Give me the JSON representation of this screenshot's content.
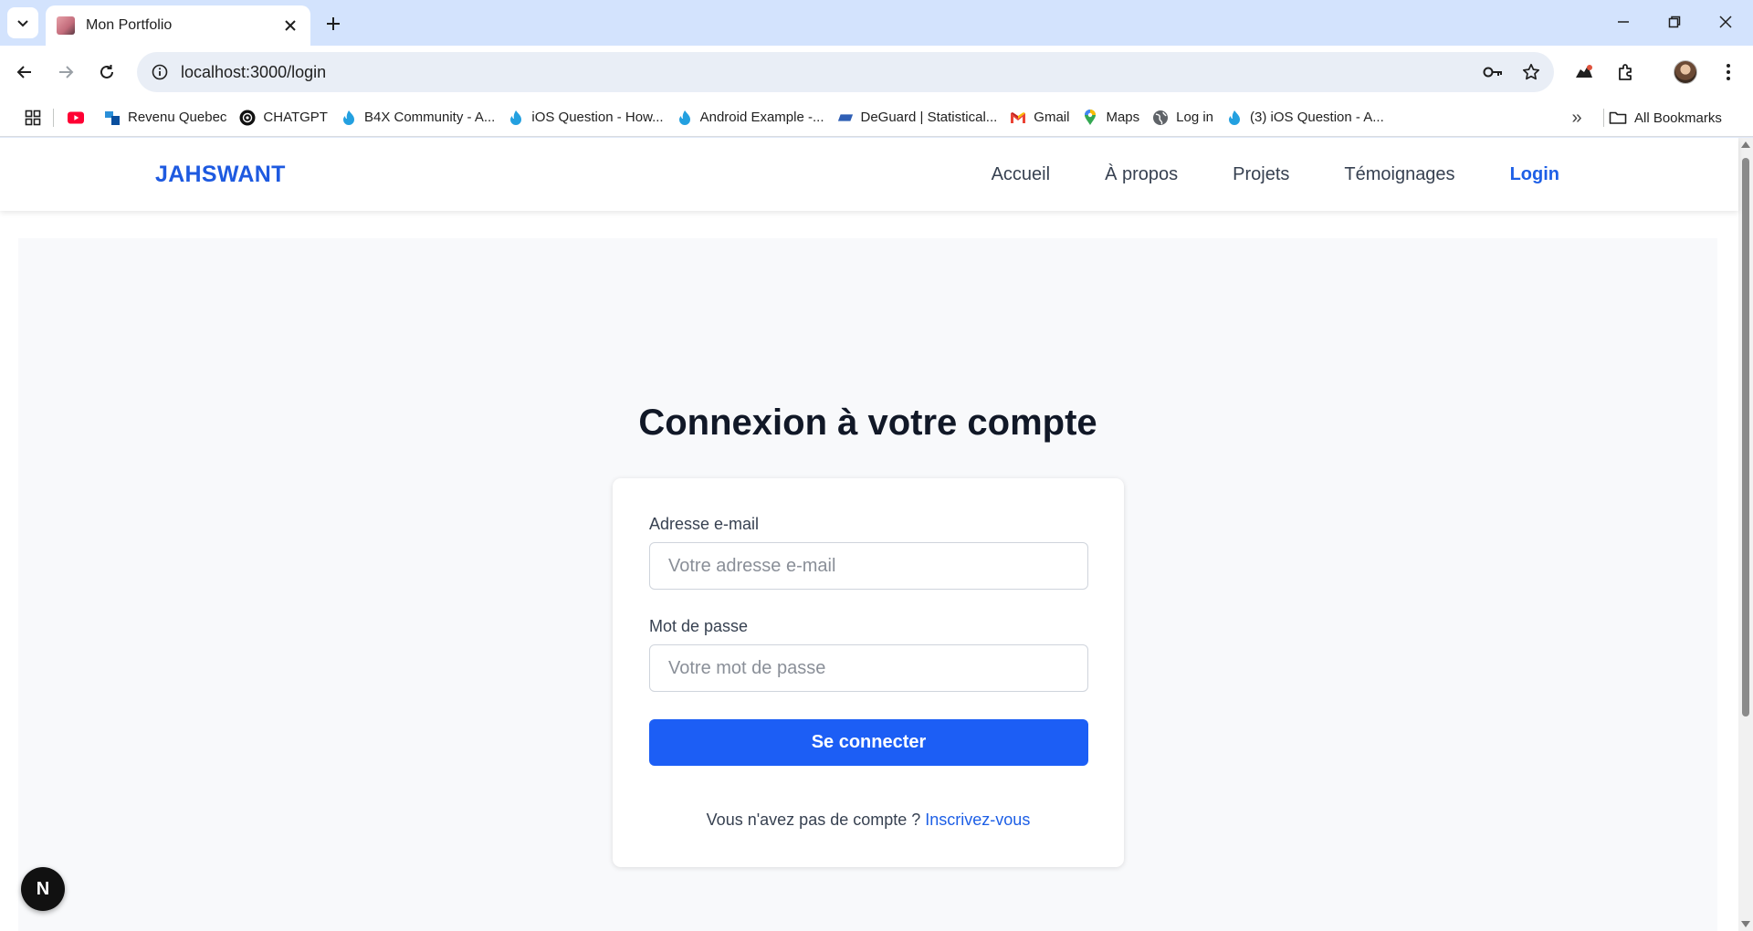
{
  "browser": {
    "tab_title": "Mon Portfolio",
    "url": "localhost:3000/login",
    "bookmarks": [
      {
        "label": "",
        "icon": "youtube-icon",
        "color": "#ff0033"
      },
      {
        "label": "Revenu Quebec",
        "icon": "revenu-quebec-icon",
        "color": "#2a8fd8"
      },
      {
        "label": "CHATGPT",
        "icon": "chatgpt-icon",
        "color": "#111111"
      },
      {
        "label": "B4X Community - A...",
        "icon": "b4x-icon",
        "color": "#23a0e0"
      },
      {
        "label": "iOS Question - How...",
        "icon": "b4x-icon",
        "color": "#23a0e0"
      },
      {
        "label": "Android Example -...",
        "icon": "b4x-icon",
        "color": "#23a0e0"
      },
      {
        "label": "DeGuard | Statistical...",
        "icon": "deguard-icon",
        "color": "#2f5fb5"
      },
      {
        "label": "Gmail",
        "icon": "gmail-icon",
        "color": "#ea4335"
      },
      {
        "label": "Maps",
        "icon": "maps-icon",
        "color": "#34a853"
      },
      {
        "label": "Log in",
        "icon": "globe-icon",
        "color": "#5f6368"
      },
      {
        "label": "(3) iOS Question - A...",
        "icon": "b4x-icon",
        "color": "#23a0e0"
      }
    ],
    "all_bookmarks_label": "All Bookmarks",
    "overflow_label": "»"
  },
  "site": {
    "brand": "JAHSWANT",
    "nav": [
      {
        "label": "Accueil",
        "active": false
      },
      {
        "label": "À propos",
        "active": false
      },
      {
        "label": "Projets",
        "active": false
      },
      {
        "label": "Témoignages",
        "active": false
      },
      {
        "label": "Login",
        "active": true
      }
    ],
    "accent_color": "#1c5ef5"
  },
  "login": {
    "heading": "Connexion à votre compte",
    "email_label": "Adresse e-mail",
    "email_placeholder": "Votre adresse e-mail",
    "email_value": "",
    "password_label": "Mot de passe",
    "password_placeholder": "Votre mot de passe",
    "password_value": "",
    "submit_label": "Se connecter",
    "signup_prompt": "Vous n'avez pas de compte ?",
    "signup_link": "Inscrivez-vous"
  },
  "dev_badge": "N"
}
